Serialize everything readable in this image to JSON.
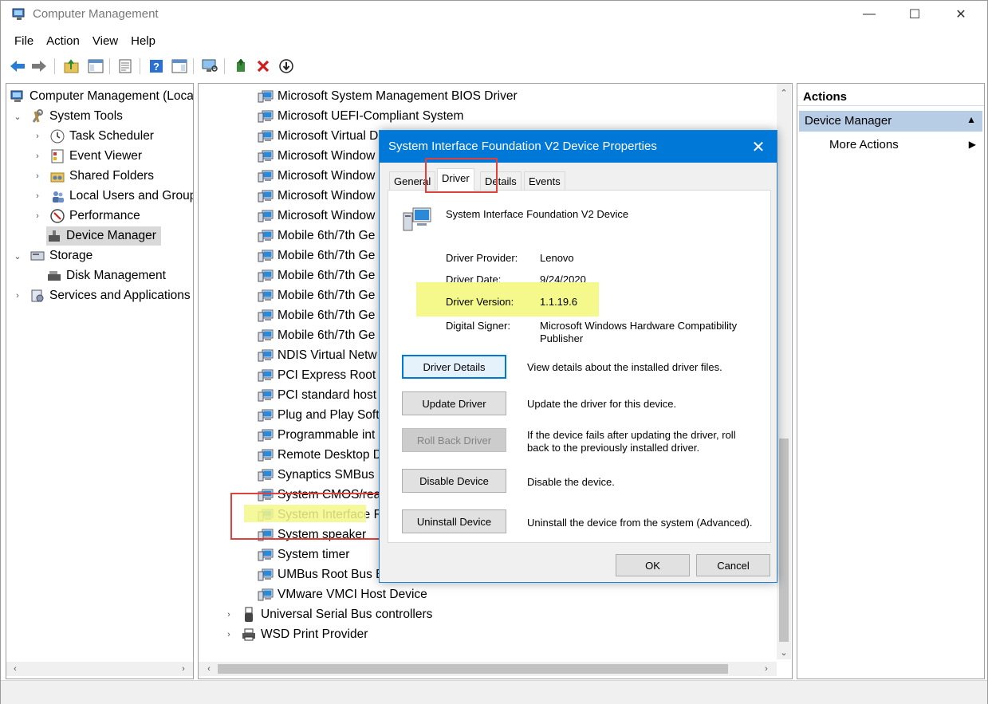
{
  "window": {
    "title": "Computer Management",
    "minimize": "—",
    "maximize": "☐",
    "close": "✕"
  },
  "menu": [
    "File",
    "Action",
    "View",
    "Help"
  ],
  "left_tree": {
    "root": "Computer Management (Local)",
    "system_tools": "System Tools",
    "task_scheduler": "Task Scheduler",
    "event_viewer": "Event Viewer",
    "shared_folders": "Shared Folders",
    "local_users": "Local Users and Groups",
    "performance": "Performance",
    "device_manager": "Device Manager",
    "storage": "Storage",
    "disk_management": "Disk Management",
    "services_apps": "Services and Applications"
  },
  "device_list": [
    "Microsoft System Management BIOS Driver",
    "Microsoft UEFI-Compliant System",
    "Microsoft Virtual D",
    "Microsoft Window",
    "Microsoft Window",
    "Microsoft Window",
    "Microsoft Window",
    "Mobile 6th/7th Ge",
    "Mobile 6th/7th Ge",
    "Mobile 6th/7th Ge",
    "Mobile 6th/7th Ge",
    "Mobile 6th/7th Ge",
    "Mobile 6th/7th Ge",
    "NDIS Virtual Netw",
    "PCI Express Root C",
    "PCI standard host",
    "Plug and Play Soft",
    "Programmable int",
    "Remote Desktop D",
    "Synaptics SMBus D",
    "System CMOS/rea",
    "System Interface F",
    "System speaker",
    "System timer",
    "UMBus Root Bus E",
    "VMware VMCI Host Device"
  ],
  "device_categories": [
    "Universal Serial Bus controllers",
    "WSD Print Provider"
  ],
  "actions": {
    "header": "Actions",
    "group": "Device Manager",
    "more": "More Actions"
  },
  "dialog": {
    "title": "System Interface Foundation V2 Device Properties",
    "tabs": [
      "General",
      "Driver",
      "Details",
      "Events"
    ],
    "device_name": "System Interface Foundation V2 Device",
    "fields": {
      "provider_label": "Driver Provider:",
      "provider_value": "Lenovo",
      "date_label": "Driver Date:",
      "date_value": "9/24/2020",
      "version_label": "Driver Version:",
      "version_value": "1.1.19.6",
      "signer_label": "Digital Signer:",
      "signer_value": "Microsoft Windows Hardware Compatibility Publisher"
    },
    "buttons": {
      "details": "Driver Details",
      "details_desc": "View details about the installed driver files.",
      "update": "Update Driver",
      "update_desc": "Update the driver for this device.",
      "rollback": "Roll Back Driver",
      "rollback_desc": "If the device fails after updating the driver, roll back to the previously installed driver.",
      "disable": "Disable Device",
      "disable_desc": "Disable the device.",
      "uninstall": "Uninstall Device",
      "uninstall_desc": "Uninstall the device from the system (Advanced)."
    },
    "ok": "OK",
    "cancel": "Cancel"
  },
  "colors": {
    "accent": "#0078d7",
    "highlight_yellow": "#f5f88a",
    "annotation_red": "#e0413c",
    "actions_group": "#b7cde5"
  }
}
